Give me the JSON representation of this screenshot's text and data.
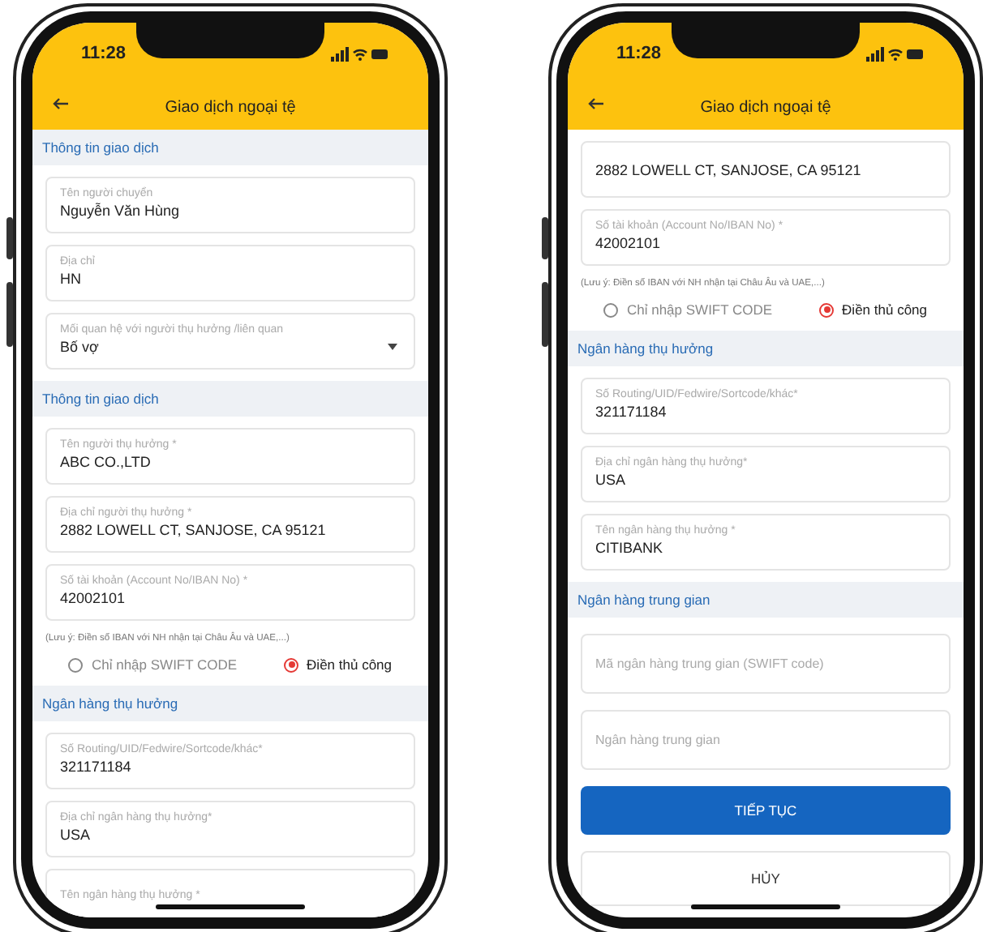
{
  "phones": [
    {
      "time": "11:28",
      "title": "Giao dịch ngoại tệ",
      "items": [
        {
          "kind": "section",
          "text": "Thông tin giao dịch"
        },
        {
          "kind": "field",
          "label": "Tên người chuyển",
          "value": "Nguyễn Văn Hùng"
        },
        {
          "kind": "field",
          "label": "Địa chỉ",
          "value": "HN"
        },
        {
          "kind": "select",
          "label": "Mối quan hệ với người thụ hưởng /liên quan",
          "value": "Bố vợ"
        },
        {
          "kind": "section",
          "text": "Thông tin giao dịch"
        },
        {
          "kind": "field",
          "label": "Tên người thụ hưởng *",
          "value": "ABC CO.,LTD"
        },
        {
          "kind": "field",
          "label": "Địa chỉ người thụ hưởng *",
          "value": "2882 LOWELL CT, SANJOSE, CA 95121"
        },
        {
          "kind": "field",
          "label": "Số tài khoản (Account No/IBAN No) *",
          "value": "42002101"
        },
        {
          "kind": "note",
          "text": "(Lưu ý: Điền số IBAN với NH nhận tại Châu Âu và UAE,...)"
        },
        {
          "kind": "radios",
          "options": [
            {
              "label": "Chỉ nhập SWIFT CODE",
              "selected": false
            },
            {
              "label": "Điền thủ công",
              "selected": true
            }
          ]
        },
        {
          "kind": "section",
          "text": "Ngân hàng thụ hưởng"
        },
        {
          "kind": "field",
          "label": "Số Routing/UID/Fedwire/Sortcode/khác*",
          "value": "321171184"
        },
        {
          "kind": "field",
          "label": "Địa chỉ ngân hàng thụ hưởng*",
          "value": "USA"
        },
        {
          "kind": "field",
          "label": "Tên ngân hàng thụ hưởng *"
        }
      ]
    },
    {
      "time": "11:28",
      "title": "Giao dịch ngoại tệ",
      "items": [
        {
          "kind": "field",
          "value": "2882 LOWELL CT, SANJOSE, CA 95121"
        },
        {
          "kind": "field",
          "label": "Số tài khoản (Account No/IBAN No) *",
          "value": "42002101"
        },
        {
          "kind": "note",
          "text": "(Lưu ý: Điền số IBAN với NH nhận tại Châu Âu và UAE,...)"
        },
        {
          "kind": "radios",
          "options": [
            {
              "label": "Chỉ nhập SWIFT CODE",
              "selected": false
            },
            {
              "label": "Điền thủ công",
              "selected": true
            }
          ]
        },
        {
          "kind": "section",
          "text": "Ngân hàng thụ hưởng"
        },
        {
          "kind": "field",
          "label": "Số Routing/UID/Fedwire/Sortcode/khác*",
          "value": "321171184"
        },
        {
          "kind": "field",
          "label": "Địa chỉ ngân hàng thụ hưởng*",
          "value": "USA"
        },
        {
          "kind": "field",
          "label": "Tên ngân hàng thụ hưởng *",
          "value": "CITIBANK"
        },
        {
          "kind": "section",
          "text": "Ngân hàng trung gian"
        },
        {
          "kind": "field",
          "placeholder": "Mã ngân hàng trung gian (SWIFT code)"
        },
        {
          "kind": "field",
          "placeholder": "Ngân hàng trung gian"
        },
        {
          "kind": "primary_button",
          "label": "TIẾP TỤC"
        },
        {
          "kind": "secondary_button",
          "label": "HỦY"
        }
      ]
    }
  ]
}
